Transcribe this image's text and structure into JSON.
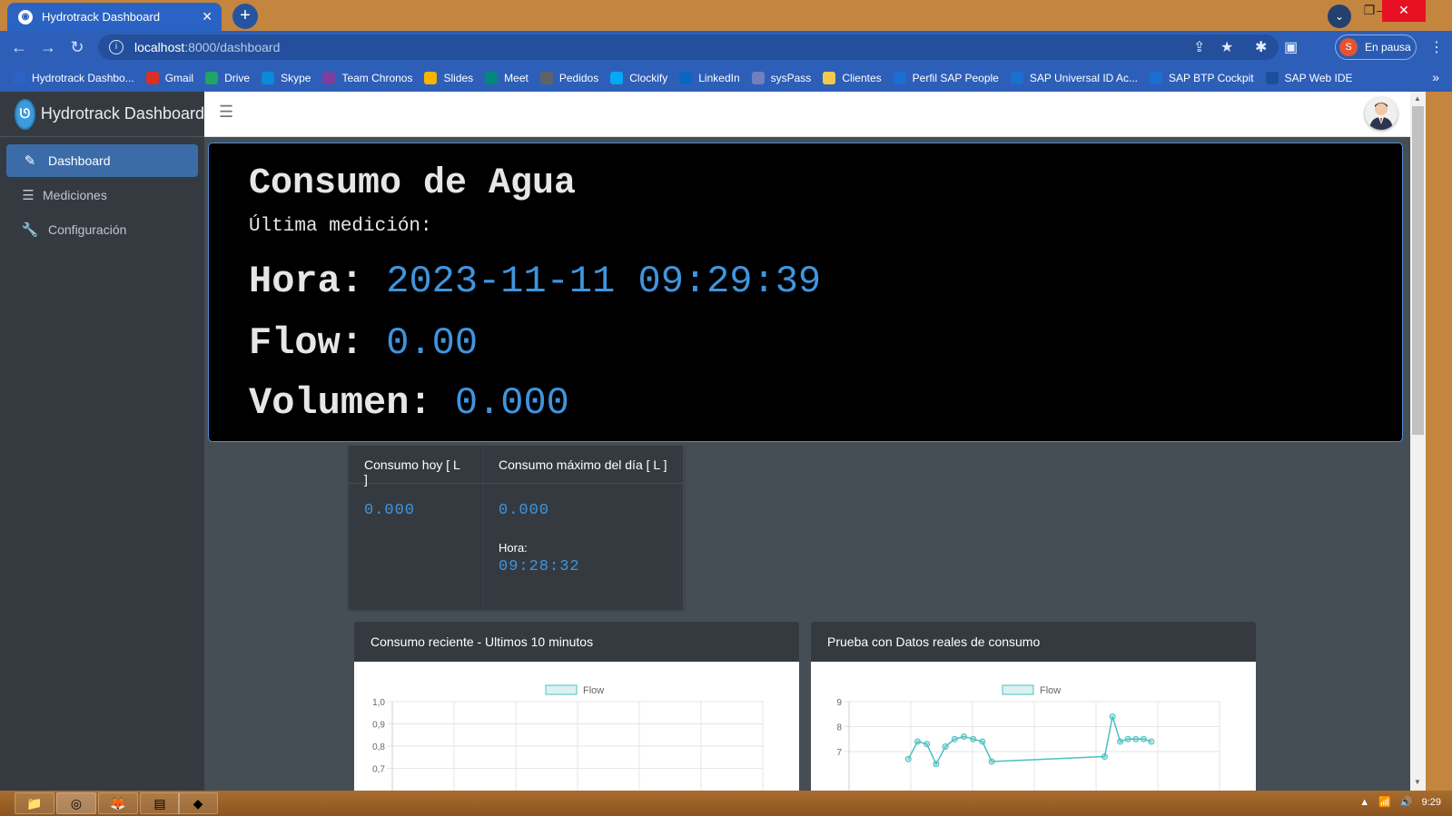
{
  "browser": {
    "tab_title": "Hydrotrack Dashboard",
    "url_host": "localhost",
    "url_path": ":8000/dashboard",
    "profile_initial": "S",
    "profile_status": "En pausa",
    "bookmarks": [
      {
        "label": "Hydrotrack Dashbo...",
        "color": "#2b63c4"
      },
      {
        "label": "Gmail",
        "color": "#d93025"
      },
      {
        "label": "Drive",
        "color": "#1fa463"
      },
      {
        "label": "Skype",
        "color": "#0a8ad8"
      },
      {
        "label": "Team Chronos",
        "color": "#7b3fa0"
      },
      {
        "label": "Slides",
        "color": "#f4b400"
      },
      {
        "label": "Meet",
        "color": "#00897b"
      },
      {
        "label": "Pedidos",
        "color": "#5f6368"
      },
      {
        "label": "Clockify",
        "color": "#03a9f4"
      },
      {
        "label": "LinkedIn",
        "color": "#0a66c2"
      },
      {
        "label": "sysPass",
        "color": "#6f7fbf"
      },
      {
        "label": "Clientes",
        "color": "#f2c94c"
      },
      {
        "label": "Perfil SAP People",
        "color": "#1c6fd1"
      },
      {
        "label": "SAP Universal ID Ac...",
        "color": "#1c6fd1"
      },
      {
        "label": "SAP BTP Cockpit",
        "color": "#1c6fd1"
      },
      {
        "label": "SAP Web IDE",
        "color": "#1c4f9a"
      }
    ]
  },
  "app": {
    "brand": "Hydrotrack Dashboard",
    "nav": [
      {
        "label": "Dashboard",
        "icon": "edit-icon",
        "active": true
      },
      {
        "label": "Mediciones",
        "icon": "list-icon",
        "active": false
      },
      {
        "label": "Configuración",
        "icon": "wrench-icon",
        "active": false
      }
    ]
  },
  "hero": {
    "title": "Consumo de Agua",
    "subtitle": "Última medición:",
    "time_label": "Hora:",
    "time_value": "2023-11-11 09:29:39",
    "flow_label": "Flow:",
    "flow_value": "0.00",
    "volume_label": "Volumen:",
    "volume_value": "0.000"
  },
  "stats": {
    "today_header": "Consumo hoy [ L ]",
    "today_value": "0.000",
    "max_header": "Consumo máximo del día [ L ]",
    "max_value": "0.000",
    "max_time_label": "Hora:",
    "max_time_value": "09:28:32"
  },
  "chart_data": [
    {
      "type": "line",
      "title": "Consumo reciente - Ultimos 10 minutos",
      "legend": [
        "Flow"
      ],
      "legend_position": "top",
      "y_ticks": [
        "1,0",
        "0,9",
        "0,8",
        "0,7"
      ],
      "series": [
        {
          "name": "Flow",
          "values": []
        }
      ],
      "color": "#4bc0c0"
    },
    {
      "type": "line",
      "title": "Prueba con Datos reales de consumo",
      "legend": [
        "Flow"
      ],
      "legend_position": "top",
      "y_ticks": [
        "9",
        "8",
        "7"
      ],
      "series": [
        {
          "name": "Flow",
          "values": [
            6.7,
            7.4,
            7.3,
            6.5,
            7.2,
            7.5,
            7.6,
            7.5,
            7.4,
            6.6,
            6.8,
            8.4,
            7.4,
            7.5,
            7.5,
            7.5,
            7.4
          ]
        }
      ],
      "color": "#4bc0c0"
    }
  ],
  "taskbar": {
    "clock": "9:29"
  }
}
